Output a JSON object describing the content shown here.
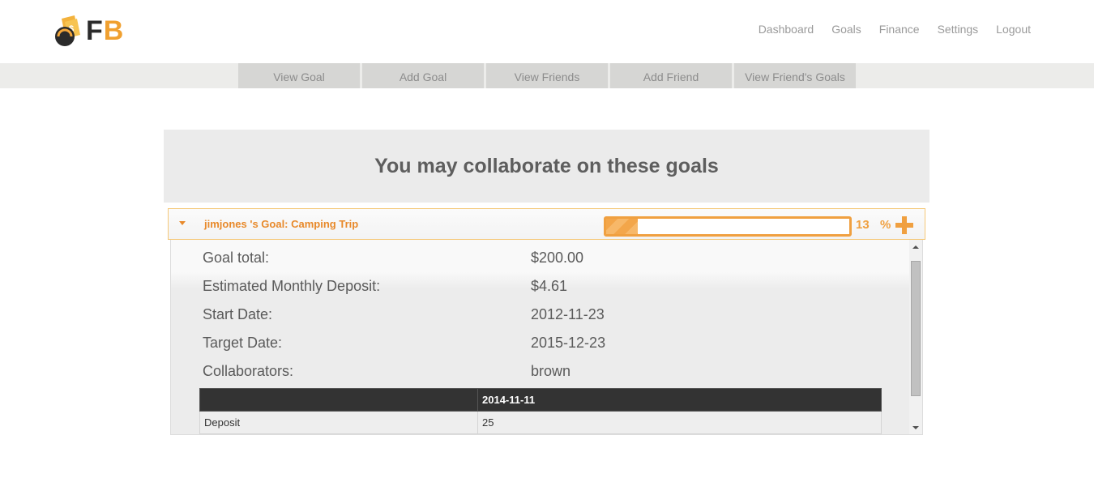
{
  "brand": {
    "logo_letter_f": "F",
    "logo_letter_b": "B"
  },
  "nav": {
    "items": [
      {
        "label": "Dashboard"
      },
      {
        "label": "Goals"
      },
      {
        "label": "Finance"
      },
      {
        "label": "Settings"
      },
      {
        "label": "Logout"
      }
    ]
  },
  "subnav": {
    "tabs": [
      {
        "label": "View Goal"
      },
      {
        "label": "Add Goal"
      },
      {
        "label": "View Friends"
      },
      {
        "label": "Add Friend"
      },
      {
        "label": "View Friend's Goals"
      }
    ]
  },
  "main": {
    "title": "You may collaborate on these goals",
    "goal": {
      "header": "jimjones 's Goal: Camping Trip",
      "progress_percent": 13,
      "percent_text": "13",
      "percent_symbol": "%",
      "details": [
        {
          "label": "Goal total:",
          "value": "$200.00"
        },
        {
          "label": "Estimated Monthly Deposit:",
          "value": "$4.61"
        },
        {
          "label": "Start Date:",
          "value": "2012-11-23"
        },
        {
          "label": "Target Date:",
          "value": "2015-12-23"
        },
        {
          "label": "Collaborators:",
          "value": "brown"
        }
      ],
      "table": {
        "headers": [
          "",
          "2014-11-11"
        ],
        "rows": [
          [
            "Deposit",
            "25"
          ]
        ]
      }
    }
  },
  "colors": {
    "accent": "#f0a040",
    "accent_text": "#e8892a",
    "table_header": "#333333"
  },
  "icons": {
    "expand": "caret-down-icon",
    "add": "plus-icon"
  }
}
